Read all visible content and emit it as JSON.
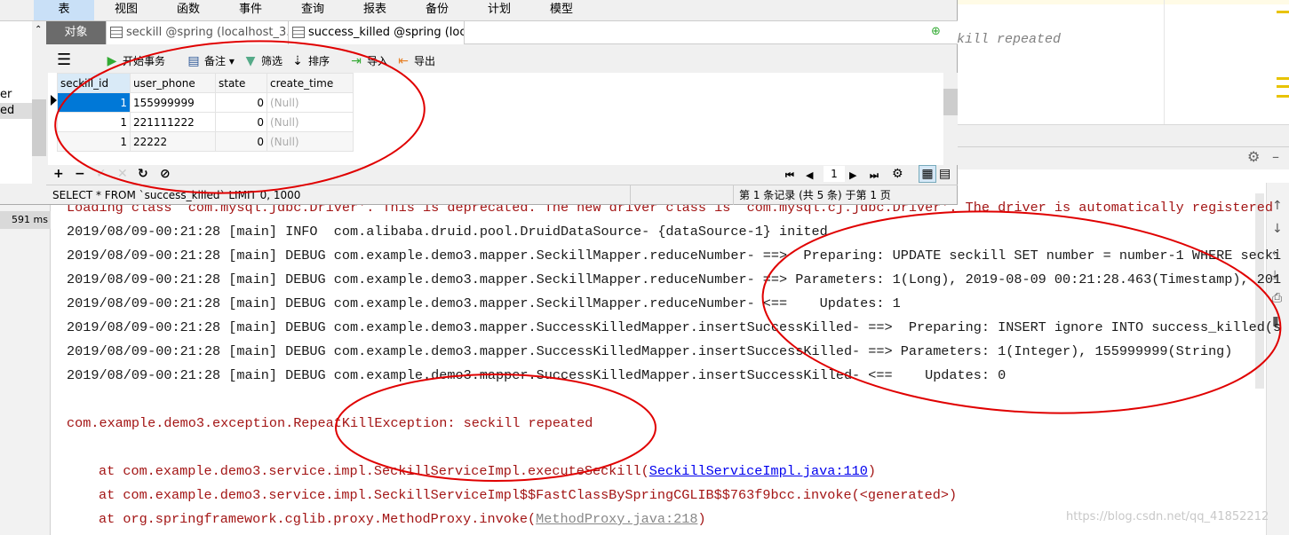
{
  "navicat": {
    "menu": [
      "表",
      "视图",
      "函数",
      "事件",
      "查询",
      "报表",
      "备份",
      "计划",
      "模型"
    ],
    "active_menu": "表",
    "left_items": [
      "er",
      "ed"
    ],
    "tabs": [
      "对象",
      "seckill @spring (localhost_3...",
      "success_killed @spring (loc..."
    ],
    "toolbar": {
      "begin_tx": "开始事务",
      "memo": "备注",
      "filter": "筛选",
      "sort": "排序",
      "import": "导入",
      "export": "导出"
    },
    "columns": [
      "seckill_id",
      "user_phone",
      "state",
      "create_time"
    ],
    "rows": [
      [
        "1",
        "155999999",
        "0",
        "(Null)"
      ],
      [
        "1",
        "221111222",
        "0",
        "(Null)"
      ],
      [
        "1",
        "22222",
        "0",
        "(Null)"
      ]
    ],
    "page": "1",
    "sql": "SELECT * FROM `success_killed` LIMIT 0, 1000",
    "record_info": "第 1 条记录 (共 5 条) 于第 1 页"
  },
  "editor": {
    "text": "ckill repeated"
  },
  "gutter": {
    "time": "591 ms"
  },
  "console": {
    "lines": [
      "Loading class `com.mysql.jdbc.Driver'. This is deprecated. The new driver class is `com.mysql.cj.jdbc.Driver'. The driver is automatically registered",
      "2019/08/09-00:21:28 [main] INFO  com.alibaba.druid.pool.DruidDataSource- {dataSource-1} inited",
      "2019/08/09-00:21:28 [main] DEBUG com.example.demo3.mapper.SeckillMapper.reduceNumber- ==>  Preparing: UPDATE seckill SET number = number-1 WHERE secki",
      "2019/08/09-00:21:28 [main] DEBUG com.example.demo3.mapper.SeckillMapper.reduceNumber- ==> Parameters: 1(Long), 2019-08-09 00:21:28.463(Timestamp), 201",
      "2019/08/09-00:21:28 [main] DEBUG com.example.demo3.mapper.SeckillMapper.reduceNumber- <==    Updates: 1",
      "2019/08/09-00:21:28 [main] DEBUG com.example.demo3.mapper.SuccessKilledMapper.insertSuccessKilled- ==>  Preparing: INSERT ignore INTO success_killed(s",
      "2019/08/09-00:21:28 [main] DEBUG com.example.demo3.mapper.SuccessKilledMapper.insertSuccessKilled- ==> Parameters: 1(Integer), 155999999(String)",
      "2019/08/09-00:21:28 [main] DEBUG com.example.demo3.mapper.SuccessKilledMapper.insertSuccessKilled- <==    Updates: 0"
    ],
    "exception": "com.example.demo3.exception.RepeatKillException: seckill repeated",
    "stack": [
      {
        "pre": "at com.example.demo3.service.impl.SeckillServiceImpl.executeSeckill(",
        "link": "SeckillServiceImpl.java:110",
        "post": ")"
      },
      {
        "pre": "at com.example.demo3.service.impl.SeckillServiceImpl$$FastClassBySpringCGLIB$$763f9bcc.invoke(<generated>)",
        "link": "",
        "post": ""
      },
      {
        "pre": "at org.springframework.cglib.proxy.MethodProxy.invoke(",
        "link": "MethodProxy.java:218",
        "post": ")"
      }
    ]
  },
  "watermark": "https://blog.csdn.net/qq_41852212",
  "colors": {
    "annotation": "#e00000",
    "error_text": "#a31515",
    "selection": "#0078d7",
    "active_menu": "#c9e0f7"
  }
}
